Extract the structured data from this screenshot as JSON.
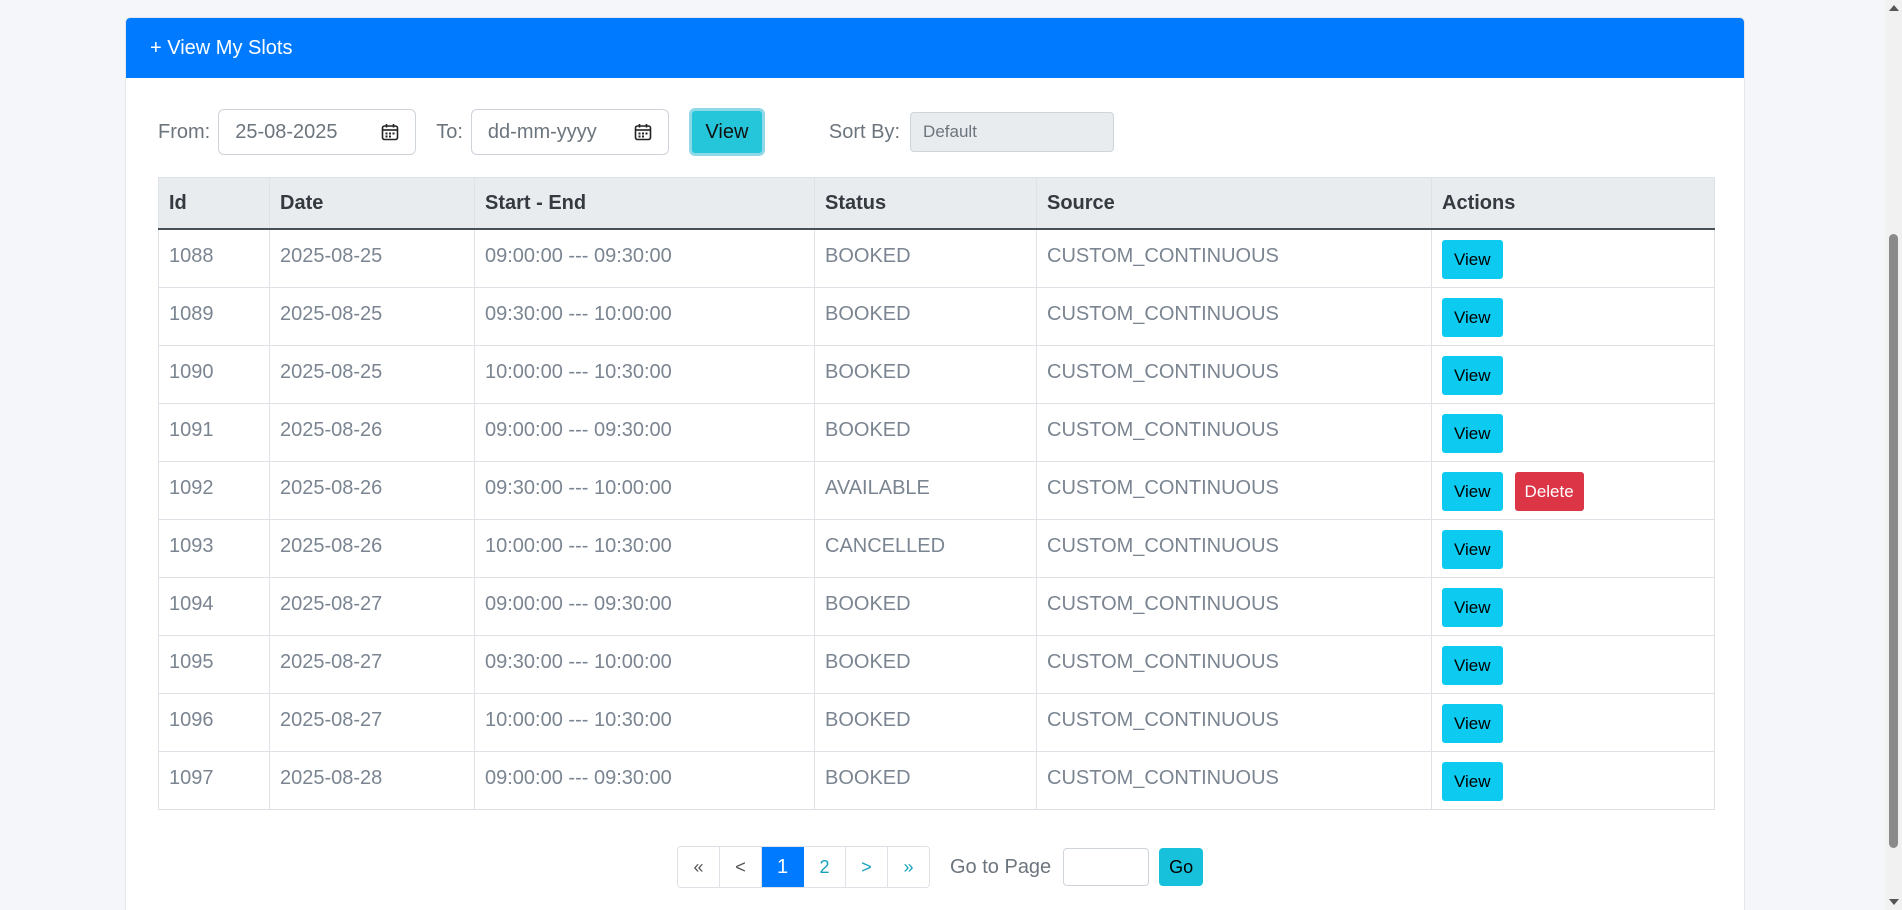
{
  "header": {
    "title": "+ View My Slots"
  },
  "filters": {
    "from_label": "From:",
    "from_value": "25-08-2025",
    "to_label": "To:",
    "to_placeholder": "dd-mm-yyyy",
    "view_label": "View",
    "sort_label": "Sort By:",
    "sort_value": "Default"
  },
  "table": {
    "columns": [
      "Id",
      "Date",
      "Start - End",
      "Status",
      "Source",
      "Actions"
    ],
    "rows": [
      {
        "id": "1088",
        "date": "2025-08-25",
        "time": "09:00:00 --- 09:30:00",
        "status": "BOOKED",
        "source": "CUSTOM_CONTINUOUS"
      },
      {
        "id": "1089",
        "date": "2025-08-25",
        "time": "09:30:00 --- 10:00:00",
        "status": "BOOKED",
        "source": "CUSTOM_CONTINUOUS"
      },
      {
        "id": "1090",
        "date": "2025-08-25",
        "time": "10:00:00 --- 10:30:00",
        "status": "BOOKED",
        "source": "CUSTOM_CONTINUOUS"
      },
      {
        "id": "1091",
        "date": "2025-08-26",
        "time": "09:00:00 --- 09:30:00",
        "status": "BOOKED",
        "source": "CUSTOM_CONTINUOUS"
      },
      {
        "id": "1092",
        "date": "2025-08-26",
        "time": "09:30:00 --- 10:00:00",
        "status": "AVAILABLE",
        "source": "CUSTOM_CONTINUOUS"
      },
      {
        "id": "1093",
        "date": "2025-08-26",
        "time": "10:00:00 --- 10:30:00",
        "status": "CANCELLED",
        "source": "CUSTOM_CONTINUOUS"
      },
      {
        "id": "1094",
        "date": "2025-08-27",
        "time": "09:00:00 --- 09:30:00",
        "status": "BOOKED",
        "source": "CUSTOM_CONTINUOUS"
      },
      {
        "id": "1095",
        "date": "2025-08-27",
        "time": "09:30:00 --- 10:00:00",
        "status": "BOOKED",
        "source": "CUSTOM_CONTINUOUS"
      },
      {
        "id": "1096",
        "date": "2025-08-27",
        "time": "10:00:00 --- 10:30:00",
        "status": "BOOKED",
        "source": "CUSTOM_CONTINUOUS"
      },
      {
        "id": "1097",
        "date": "2025-08-28",
        "time": "09:00:00 --- 09:30:00",
        "status": "BOOKED",
        "source": "CUSTOM_CONTINUOUS"
      }
    ],
    "view_label": "View",
    "delete_label": "Delete"
  },
  "pagination": {
    "first": "«",
    "prev": "<",
    "pages": [
      "1",
      "2"
    ],
    "current": "1",
    "next": ">",
    "last": "»",
    "goto_label": "Go to Page",
    "go_label": "Go"
  },
  "colors": {
    "primary": "#007bff",
    "info": "#0dcaf0",
    "danger": "#dc3545"
  }
}
